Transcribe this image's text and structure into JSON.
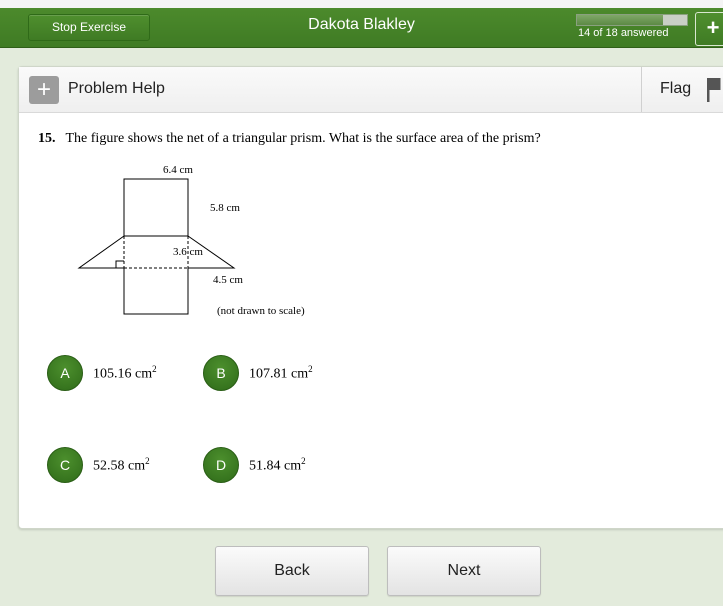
{
  "header": {
    "stop_label": "Stop Exercise",
    "student_name": "Dakota Blakley",
    "progress_text": "14 of 18 answered",
    "progress_fraction": 0.778,
    "plus_label": "+"
  },
  "panel": {
    "help_plus": "+",
    "help_label": "Problem Help",
    "flag_label": "Flag"
  },
  "question": {
    "number": "15.",
    "text": "The figure shows the net of a triangular prism. What is the surface area of the prism?"
  },
  "figure": {
    "labels": {
      "top": "6.4 cm",
      "side": "5.8 cm",
      "height": "3.6 cm",
      "base_side": "4.5 cm",
      "note": "(not drawn to scale)"
    }
  },
  "choices": [
    {
      "letter": "A",
      "value": "105.16 cm",
      "unit_exp": "2"
    },
    {
      "letter": "B",
      "value": "107.81 cm",
      "unit_exp": "2"
    },
    {
      "letter": "C",
      "value": "52.58 cm",
      "unit_exp": "2"
    },
    {
      "letter": "D",
      "value": "51.84 cm",
      "unit_exp": "2"
    }
  ],
  "nav": {
    "back_label": "Back",
    "next_label": "Next"
  }
}
